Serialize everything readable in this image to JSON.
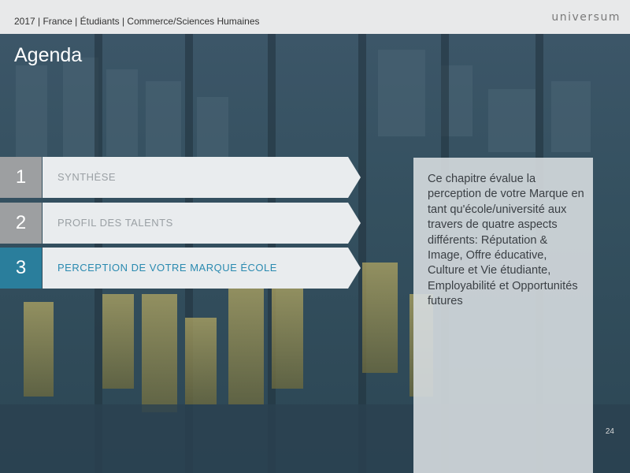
{
  "header": {
    "breadcrumb": "2017 | France | Étudiants | Commerce/Sciences Humaines",
    "logo": "universum"
  },
  "title": "Agenda",
  "agenda": [
    {
      "number": "1",
      "label": "SYNTHÈSE",
      "active": false
    },
    {
      "number": "2",
      "label": "PROFIL DES TALENTS",
      "active": false
    },
    {
      "number": "3",
      "label": "PERCEPTION DE VOTRE MARQUE ÉCOLE",
      "active": true
    }
  ],
  "info": "Ce chapitre évalue la perception de votre Marque en tant qu'école/université aux travers de quatre aspects différents: Réputation & Image, Offre éducative, Culture et Vie étudiante, Employabilité et Opportunités futures",
  "page_number": "24",
  "colors": {
    "active": "#2a7e9c",
    "inactive_number": "#9d9fa1",
    "tab": "#e9ecee"
  }
}
